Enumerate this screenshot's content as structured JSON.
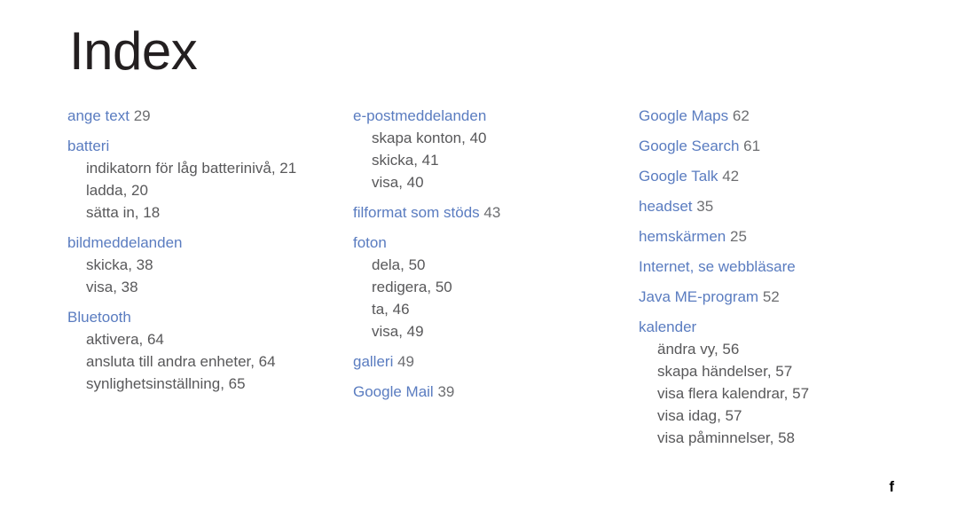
{
  "page": {
    "title": "Index",
    "footer_mark": "f",
    "background_color": "#ffffff",
    "heading_color": "#5a7cc0",
    "subentry_color": "#58585a",
    "title_color": "#231f20"
  },
  "columns": [
    {
      "name": "column-1",
      "groups": [
        {
          "heading": "ange text",
          "page": "29",
          "sub_entries": []
        },
        {
          "heading": "batteri",
          "page": "",
          "sub_entries": [
            "indikatorn för låg batterinivå, 21",
            "ladda, 20",
            "sätta in, 18"
          ]
        },
        {
          "heading": "bildmeddelanden",
          "page": "",
          "sub_entries": [
            "skicka, 38",
            "visa, 38"
          ]
        },
        {
          "heading": "Bluetooth",
          "page": "",
          "sub_entries": [
            "aktivera, 64",
            "ansluta till andra enheter, 64",
            "synlighetsinställning, 65"
          ]
        }
      ]
    },
    {
      "name": "column-2",
      "groups": [
        {
          "heading": "e-postmeddelanden",
          "page": "",
          "sub_entries": [
            "skapa konton, 40",
            "skicka, 41",
            "visa, 40"
          ]
        },
        {
          "heading": "filformat som stöds",
          "page": "43",
          "sub_entries": []
        },
        {
          "heading": "foton",
          "page": "",
          "sub_entries": [
            "dela, 50",
            "redigera, 50",
            "ta, 46",
            "visa, 49"
          ]
        },
        {
          "heading": "galleri",
          "page": "49",
          "sub_entries": []
        },
        {
          "heading": "Google Mail",
          "page": "39",
          "sub_entries": []
        }
      ]
    },
    {
      "name": "column-3",
      "groups": [
        {
          "heading": "Google Maps",
          "page": "62",
          "sub_entries": []
        },
        {
          "heading": "Google Search",
          "page": "61",
          "sub_entries": []
        },
        {
          "heading": "Google Talk",
          "page": "42",
          "sub_entries": []
        },
        {
          "heading": "headset",
          "page": "35",
          "sub_entries": []
        },
        {
          "heading": "hemskärmen",
          "page": "25",
          "sub_entries": []
        },
        {
          "heading": "Internet, se webbläsare",
          "page": "",
          "sub_entries": []
        },
        {
          "heading": "Java ME-program",
          "page": "52",
          "sub_entries": []
        },
        {
          "heading": "kalender",
          "page": "",
          "sub_entries": [
            "ändra vy, 56",
            "skapa händelser, 57",
            "visa flera kalendrar, 57",
            "visa idag, 57",
            "visa påminnelser, 58"
          ]
        }
      ]
    }
  ]
}
